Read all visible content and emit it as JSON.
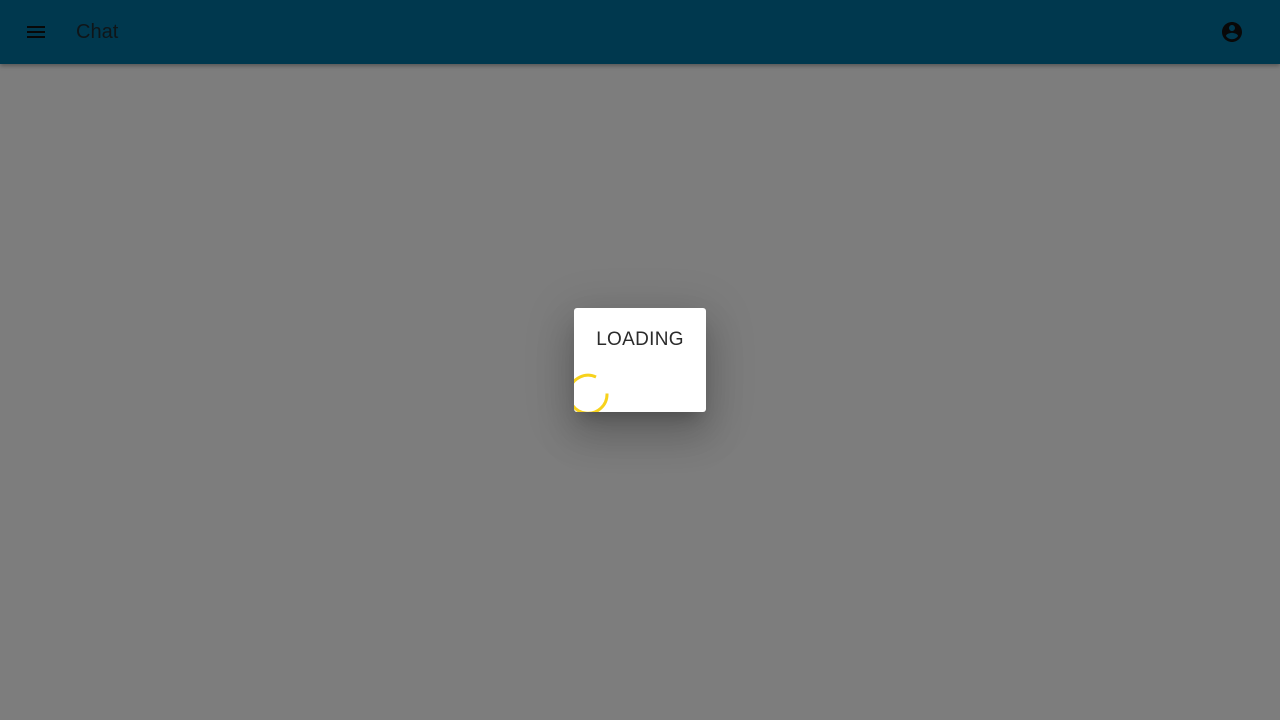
{
  "toolbar": {
    "title": "Chat",
    "menu_icon": "menu-icon",
    "account_icon": "account-circle-icon",
    "background_color": "#01709c"
  },
  "dialog": {
    "title": "LOADING",
    "spinner_icon": "progress-spinner-icon",
    "spinner_color": "#f7d21c"
  },
  "backdrop": {
    "color": "#808080"
  }
}
